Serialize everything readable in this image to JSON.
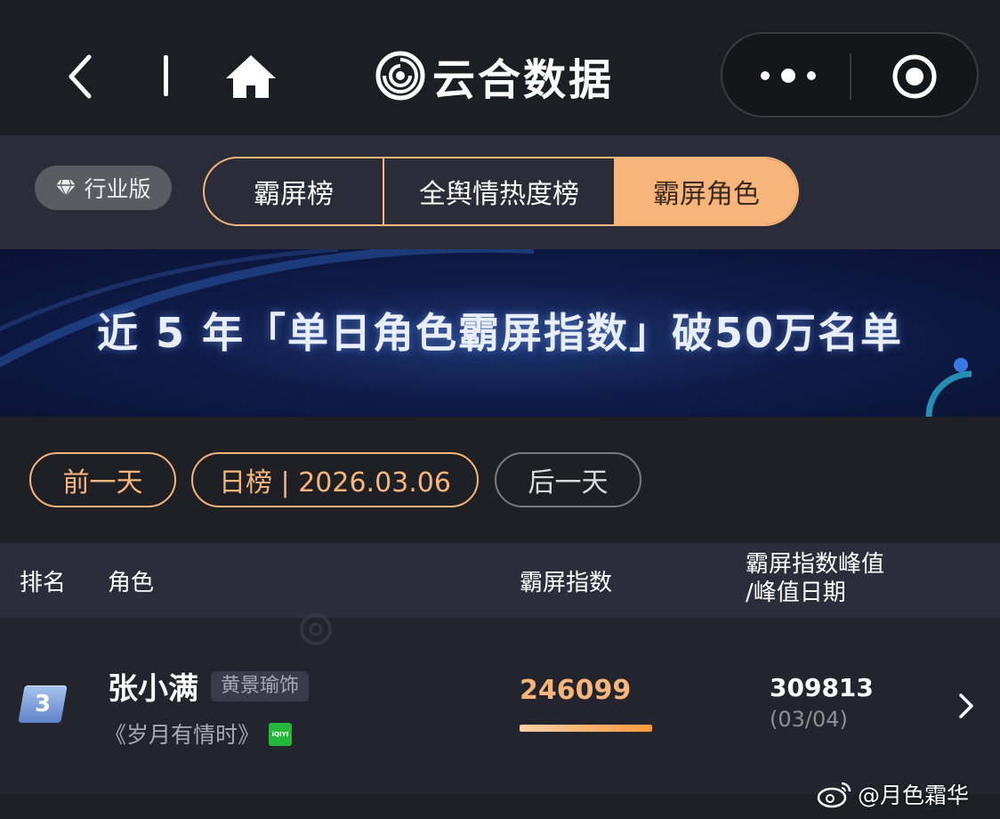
{
  "nav": {
    "icons": [
      "chevron-left-icon",
      "home-icon",
      "more-dots-icon",
      "target-close-icon"
    ]
  },
  "brand": {
    "title": "云合数据",
    "logo": "yunhe-logo"
  },
  "edition": {
    "label": "行业版",
    "icon": "diamond-icon"
  },
  "tabs": [
    {
      "label": "霸屏榜",
      "active": false
    },
    {
      "label": "全舆情热度榜",
      "active": false
    },
    {
      "label": "霸屏角色",
      "active": true
    }
  ],
  "banner": {
    "text": "近 5 年「单日角色霸屏指数」破50万名单"
  },
  "date_nav": {
    "prev": "前一天",
    "current": "日榜 | 2026.03.06",
    "next": "后一天"
  },
  "table": {
    "headers": {
      "rank": "排名",
      "role": "角色",
      "index": "霸屏指数",
      "peak_line1": "霸屏指数峰值",
      "peak_line2": "/峰值日期"
    },
    "rows": [
      {
        "rank": "3",
        "role": "张小满",
        "actor": "黄景瑜饰",
        "drama": "《岁月有情时》",
        "platform": "iQIYI",
        "index": "246099",
        "index_ratio": 0.794,
        "peak": "309813",
        "peak_date": "(03/04)"
      }
    ]
  },
  "watermark": {
    "text": "@月色霜华"
  },
  "colors": {
    "accent": "#f7b57c",
    "background": "#1f2026",
    "tab_bar": "#2a2c38",
    "banner": "#0f1c4a",
    "rank_badge": "#7d9fdc"
  }
}
